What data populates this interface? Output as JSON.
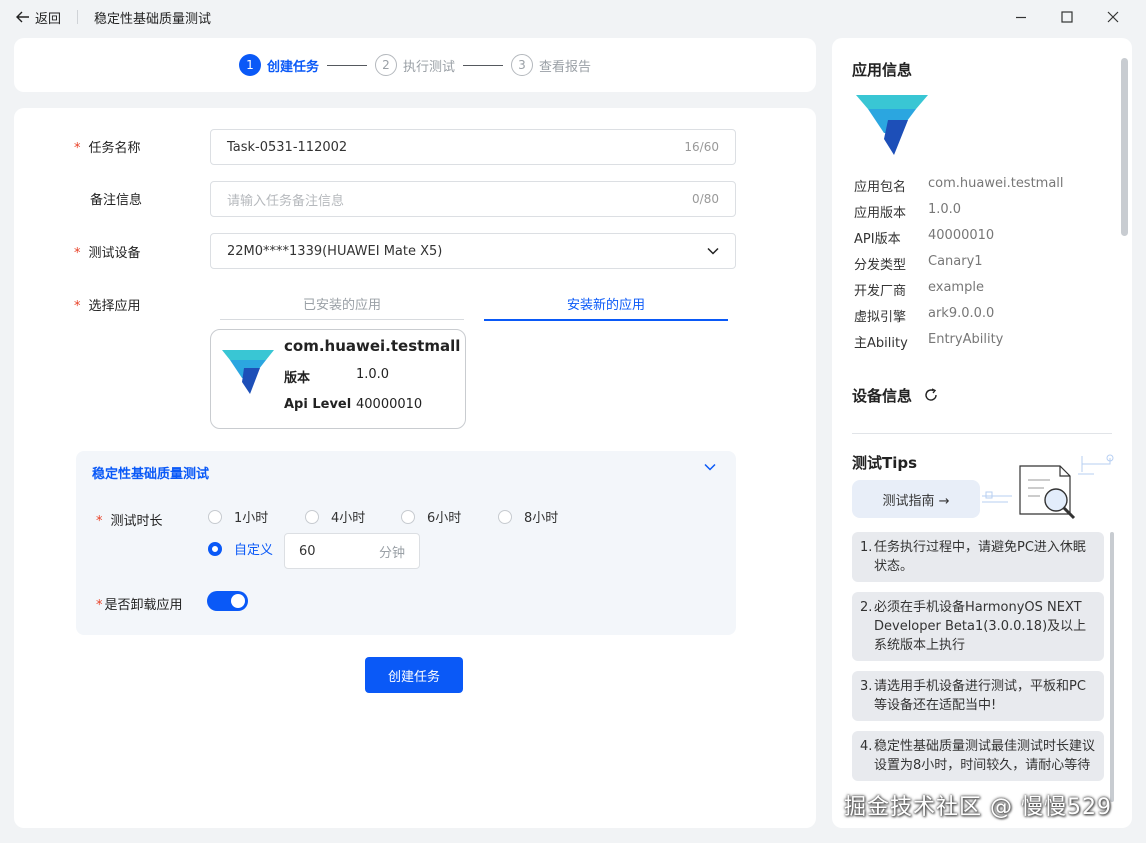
{
  "titlebar": {
    "back_label": "返回",
    "title": "稳定性基础质量测试"
  },
  "stepper": {
    "steps": [
      {
        "num": "1",
        "label": "创建任务",
        "state": "active"
      },
      {
        "num": "2",
        "label": "执行测试",
        "state": "todo"
      },
      {
        "num": "3",
        "label": "查看报告",
        "state": "todo"
      }
    ]
  },
  "form": {
    "task_name": {
      "label": "任务名称",
      "value": "Task-0531-112002",
      "count": "16/60"
    },
    "remark": {
      "label": "备注信息",
      "placeholder": "请输入任务备注信息",
      "count": "0/80"
    },
    "device": {
      "label": "测试设备",
      "value": "22M0****1339(HUAWEI Mate X5)"
    },
    "app": {
      "label": "选择应用",
      "tabs": [
        "已安装的应用",
        "安装新的应用"
      ],
      "active_tab": 1,
      "card": {
        "package": "com.huawei.testmall",
        "version_label": "版本",
        "version": "1.0.0",
        "api_label": "Api Level",
        "api": "40000010"
      }
    },
    "test_panel": {
      "title": "稳定性基础质量测试",
      "duration_label": "测试时长",
      "options": [
        "1小时",
        "4小时",
        "6小时",
        "8小时"
      ],
      "custom_label": "自定义",
      "custom_value": "60",
      "custom_unit": "分钟",
      "uninstall_label": "是否卸载应用",
      "uninstall_enabled": true
    },
    "submit_label": "创建任务"
  },
  "side": {
    "app_info_title": "应用信息",
    "app_info": [
      {
        "k": "应用包名",
        "v": "com.huawei.testmall"
      },
      {
        "k": "应用版本",
        "v": "1.0.0"
      },
      {
        "k": "API版本",
        "v": "40000010"
      },
      {
        "k": "分发类型",
        "v": "Canary1"
      },
      {
        "k": "开发厂商",
        "v": "example"
      },
      {
        "k": "虚拟引擎",
        "v": "ark9.0.0.0"
      },
      {
        "k": "主Ability",
        "v": "EntryAbility"
      }
    ],
    "device_info_title": "设备信息",
    "tips_title": "测试Tips",
    "guide_label": "测试指南 →",
    "tips": [
      {
        "n": "1.",
        "text": "任务执行过程中，请避免PC进入休眠状态。"
      },
      {
        "n": "2.",
        "text": "必须在手机设备HarmonyOS NEXT Developer Beta1(3.0.0.18)及以上系统版本上执行"
      },
      {
        "n": "3.",
        "text": "请选用手机设备进行测试，平板和PC等设备还在适配当中!"
      },
      {
        "n": "4.",
        "text": "稳定性基础质量测试最佳测试时长建议设置为8小时，时间较久，请耐心等待"
      }
    ]
  },
  "watermark": "掘金技术社区 @ 慢慢529",
  "colors": {
    "accent": "#0a59f7",
    "required": "#e84026"
  }
}
